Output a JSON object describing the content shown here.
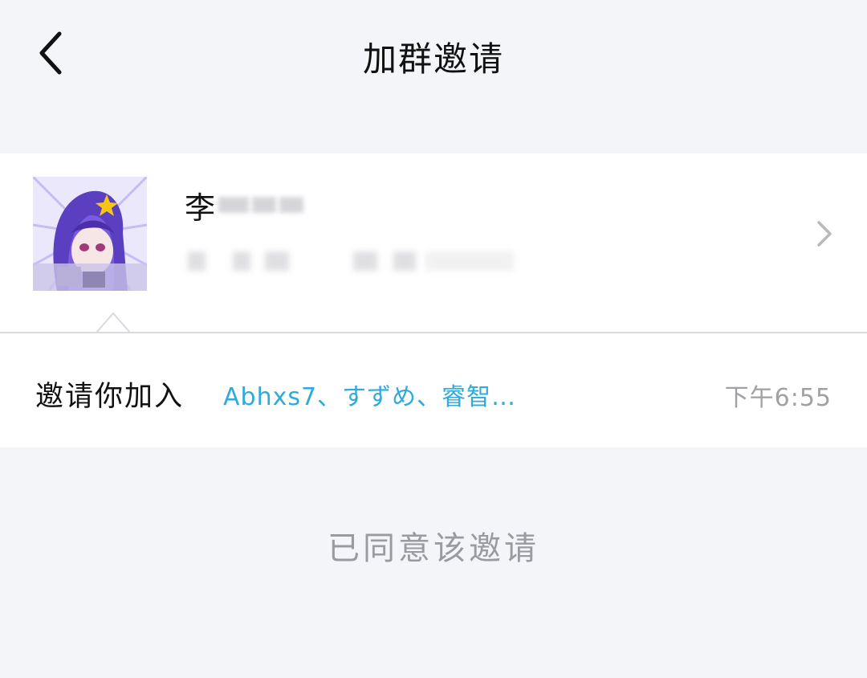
{
  "header": {
    "title": "加群邀请"
  },
  "profile": {
    "name_visible": "李",
    "avatar_icon": "anime-avatar-icon"
  },
  "invite": {
    "prefix": "邀请你加入",
    "members": "Abhxs7、すずめ、睿智…",
    "time": "下午6:55"
  },
  "status": {
    "text": "已同意该邀请"
  },
  "colors": {
    "background": "#f4f5f9",
    "card": "#ffffff",
    "link": "#2eaadb",
    "muted": "#a0a0a5"
  }
}
